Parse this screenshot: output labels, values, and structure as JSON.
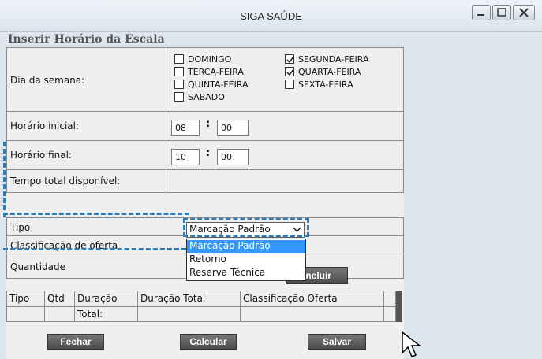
{
  "window": {
    "title": "SIGA SAÚDE"
  },
  "form": {
    "title": "Inserir Horário da Escala",
    "day_label": "Dia da semana:",
    "days": [
      {
        "label": "DOMINGO",
        "checked": false
      },
      {
        "label": "TERCA-FEIRA",
        "checked": false
      },
      {
        "label": "QUINTA-FEIRA",
        "checked": false
      },
      {
        "label": "SABADO",
        "checked": false
      },
      {
        "label": "SEGUNDA-FEIRA",
        "checked": true
      },
      {
        "label": "QUARTA-FEIRA",
        "checked": true
      },
      {
        "label": "SEXTA-FEIRA",
        "checked": false
      }
    ],
    "start_label": "Horário inicial:",
    "start_hour": "08",
    "start_min": "00",
    "end_label": "Horário final:",
    "end_hour": "10",
    "end_min": "00",
    "total_label": "Tempo total disponível:",
    "tipo_label": "Tipo",
    "tipo_value": "Marcação Padrão",
    "tipo_options": [
      "Marcação Padrão",
      "Retorno",
      "Reserva Técnica"
    ],
    "classificacao_label": "Classificação de oferta",
    "quantidade_label": "Quantidade",
    "incluir_label": "Incluir",
    "colon": ":"
  },
  "table": {
    "headers": [
      "Tipo",
      "Qtd",
      "Duração",
      "Duração Total",
      "Classificação Oferta"
    ],
    "total_label": "Total:"
  },
  "buttons": {
    "fechar": "Fechar",
    "calcular": "Calcular",
    "salvar": "Salvar"
  }
}
